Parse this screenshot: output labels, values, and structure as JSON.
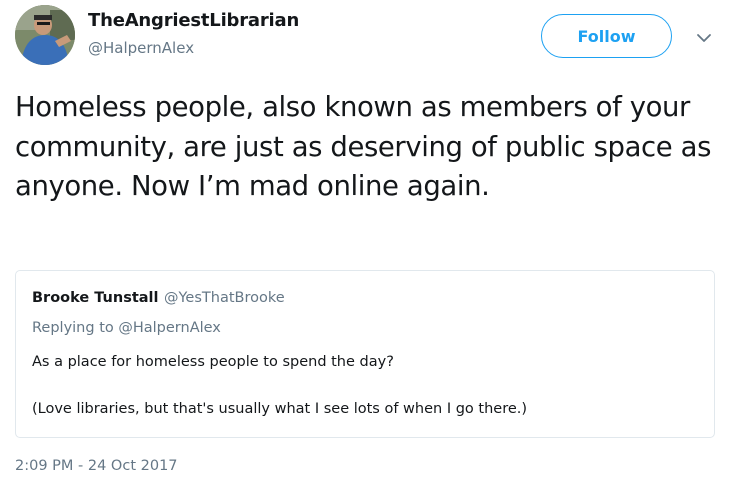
{
  "author": {
    "display_name": "TheAngriestLibrarian",
    "handle": "@HalpernAlex"
  },
  "follow_button": {
    "label": "Follow"
  },
  "menu": {
    "icon": "chevron-down-icon"
  },
  "tweet": {
    "text": "Homeless people, also known as members of your community, are just as deserving of public space as anyone. Now I’m mad online again.",
    "timestamp": "2:09 PM - 24 Oct 2017"
  },
  "quoted_tweet": {
    "display_name": "Brooke Tunstall",
    "handle": "@YesThatBrooke",
    "replying_to": "Replying to @HalpernAlex",
    "line1": "As a place for homeless people to spend the day?",
    "line2": "(Love libraries, but that's usually what I see lots of when I go there.)"
  },
  "colors": {
    "accent": "#1da1f2",
    "text": "#14171a",
    "secondary_text": "#657786",
    "border": "#e1e8ed"
  }
}
